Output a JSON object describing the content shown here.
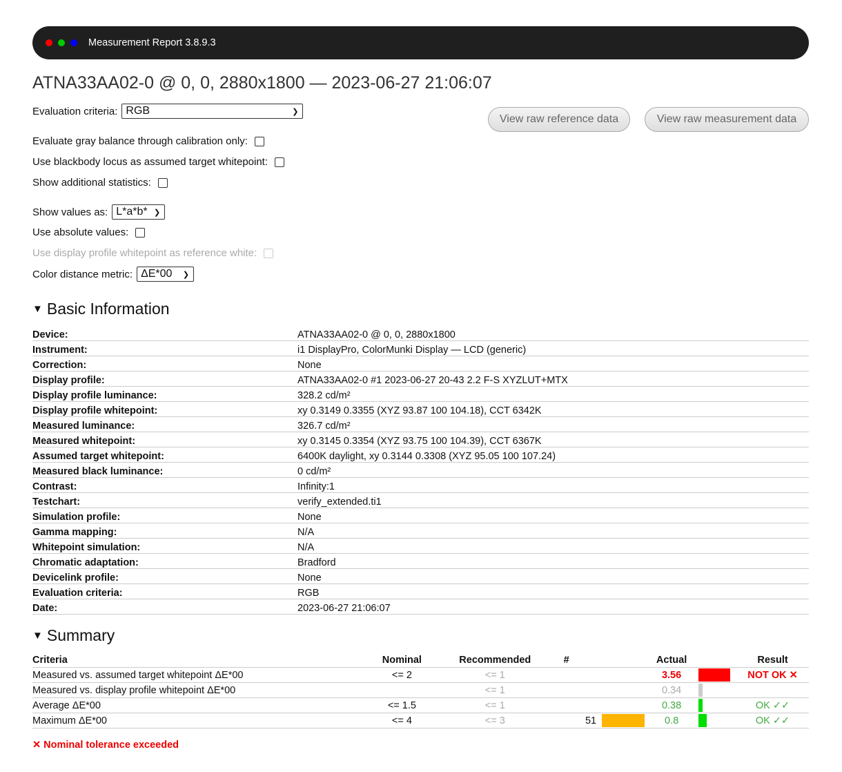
{
  "window": {
    "title": "Measurement Report 3.8.9.3",
    "dot_colors": [
      "#ff0000",
      "#00cc00",
      "#0000ff"
    ]
  },
  "page_title": "ATNA33AA02-0 @ 0, 0, 2880x1800 — 2023-06-27 21:06:07",
  "controls": {
    "evaluation_criteria_label": "Evaluation criteria:",
    "evaluation_criteria_value": "RGB",
    "gray_balance_label": "Evaluate gray balance through calibration only:",
    "blackbody_label": "Use blackbody locus as assumed target whitepoint:",
    "additional_stats_label": "Show additional statistics:",
    "show_values_label": "Show values as:",
    "show_values_value": "L*a*b*",
    "absolute_values_label": "Use absolute values:",
    "profile_whitepoint_label": "Use display profile whitepoint as reference white:",
    "distance_metric_label": "Color distance metric:",
    "distance_metric_value": "ΔE*00"
  },
  "buttons": {
    "raw_reference": "View raw reference data",
    "raw_measurement": "View raw measurement data"
  },
  "basic_info": {
    "heading": "Basic Information",
    "rows": [
      {
        "key": "Device:",
        "value": "ATNA33AA02-0 @ 0, 0, 2880x1800"
      },
      {
        "key": "Instrument:",
        "value": "i1 DisplayPro, ColorMunki Display — LCD (generic)"
      },
      {
        "key": "Correction:",
        "value": "None"
      },
      {
        "key": "Display profile:",
        "value": "ATNA33AA02-0 #1 2023-06-27 20-43 2.2 F-S XYZLUT+MTX"
      },
      {
        "key": "Display profile luminance:",
        "value": "328.2 cd/m²"
      },
      {
        "key": "Display profile whitepoint:",
        "value": "xy 0.3149 0.3355 (XYZ 93.87 100 104.18), CCT 6342K"
      },
      {
        "key": "Measured luminance:",
        "value": "326.7 cd/m²"
      },
      {
        "key": "Measured whitepoint:",
        "value": "xy 0.3145 0.3354 (XYZ 93.75 100 104.39), CCT 6367K"
      },
      {
        "key": "Assumed target whitepoint:",
        "value": "6400K daylight, xy 0.3144 0.3308 (XYZ 95.05 100 107.24)"
      },
      {
        "key": "Measured black luminance:",
        "value": "0 cd/m²"
      },
      {
        "key": "Contrast:",
        "value": "Infinity:1"
      },
      {
        "key": "Testchart:",
        "value": "verify_extended.ti1"
      },
      {
        "key": "Simulation profile:",
        "value": "None"
      },
      {
        "key": "Gamma mapping:",
        "value": "N/A"
      },
      {
        "key": "Whitepoint simulation:",
        "value": "N/A"
      },
      {
        "key": "Chromatic adaptation:",
        "value": "Bradford"
      },
      {
        "key": "Devicelink profile:",
        "value": "None"
      },
      {
        "key": "Evaluation criteria:",
        "value": "RGB"
      },
      {
        "key": "Date:",
        "value": "2023-06-27 21:06:07"
      }
    ]
  },
  "summary": {
    "heading": "Summary",
    "headers": {
      "criteria": "Criteria",
      "nominal": "Nominal",
      "recommended": "Recommended",
      "count": "#",
      "actual": "Actual",
      "result": "Result"
    },
    "rows": [
      {
        "criteria": "Measured vs. assumed target whitepoint ΔE*00",
        "nominal": "<= 2",
        "recommended": "<= 1",
        "count": "",
        "count_bar_fraction": 0,
        "actual": "3.56",
        "actual_bar_fraction": 1.0,
        "actual_bar_color": "#ff0000",
        "actual_style": "red",
        "result": "NOT OK ✕",
        "result_style": "red"
      },
      {
        "criteria": "Measured vs. display profile whitepoint ΔE*00",
        "nominal": "",
        "recommended": "<= 1",
        "count": "",
        "count_bar_fraction": 0,
        "actual": "0.34",
        "actual_bar_fraction": 0.12,
        "actual_bar_color": "#cccccc",
        "actual_style": "gray",
        "result": "",
        "result_style": ""
      },
      {
        "criteria": "Average ΔE*00",
        "nominal": "<= 1.5",
        "recommended": "<= 1",
        "count": "",
        "count_bar_fraction": 0,
        "actual": "0.38",
        "actual_bar_fraction": 0.13,
        "actual_bar_color": "#00dd00",
        "actual_style": "green",
        "result": "OK ✓✓",
        "result_style": "green"
      },
      {
        "criteria": "Maximum ΔE*00",
        "nominal": "<= 4",
        "recommended": "<= 3",
        "count": "51",
        "count_bar_fraction": 1.0,
        "actual": "0.8",
        "actual_bar_fraction": 0.25,
        "actual_bar_color": "#00dd00",
        "actual_style": "green",
        "result": "OK ✓✓",
        "result_style": "green"
      }
    ],
    "count_bar_color": "#ffb400"
  },
  "note": "✕ Nominal tolerance exceeded"
}
